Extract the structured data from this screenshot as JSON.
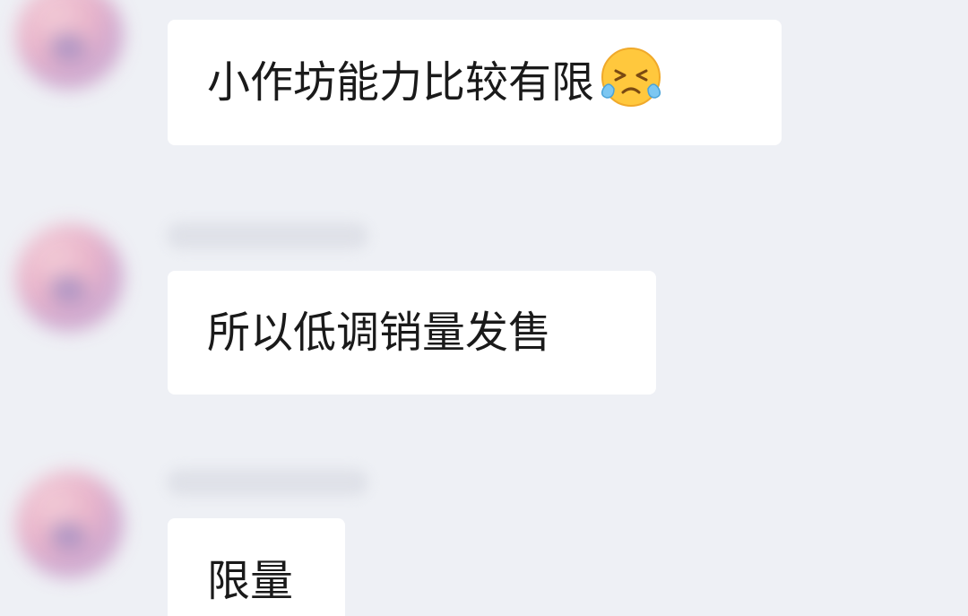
{
  "messages": [
    {
      "text": "小作坊能力比较有限",
      "emoji": "crying-laughing-face-emoji"
    },
    {
      "text": "所以低调销量发售"
    },
    {
      "text": "限量"
    }
  ]
}
